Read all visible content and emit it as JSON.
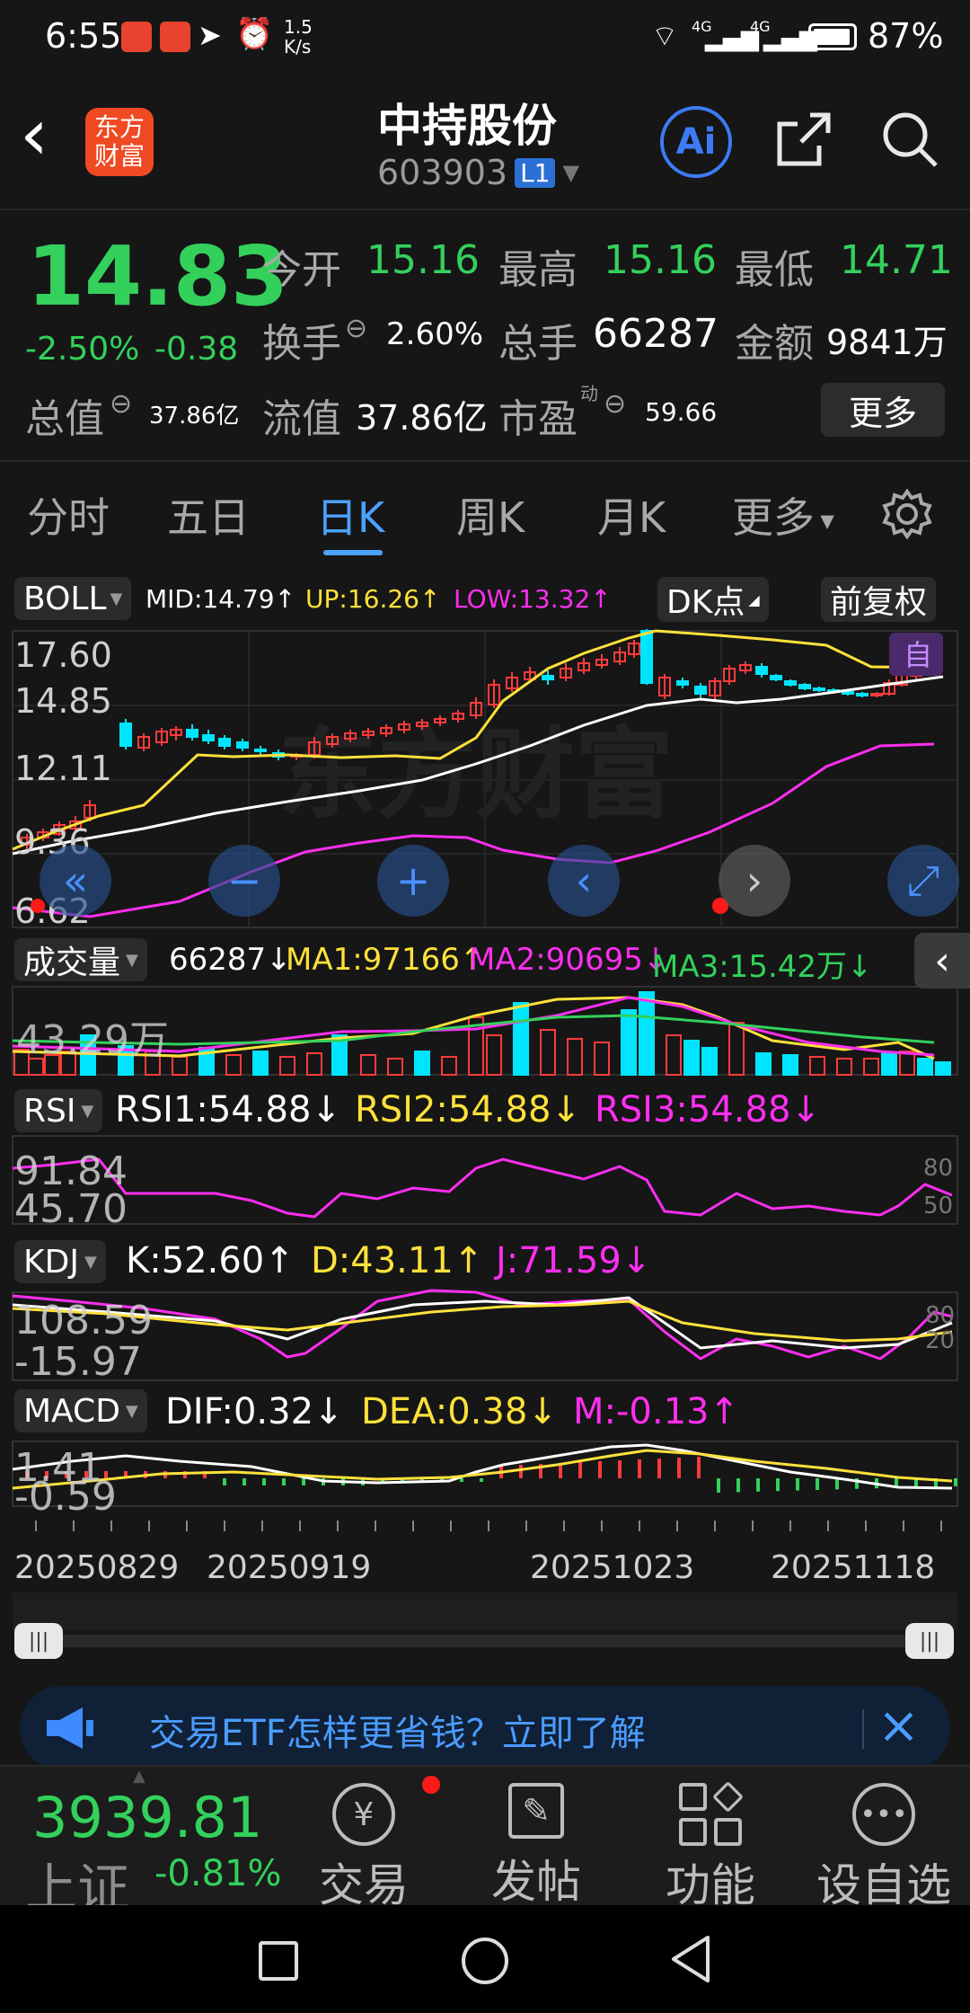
{
  "status_bar": {
    "time": "6:55",
    "speed": "1.5",
    "speed_unit": "K/s",
    "signal1": "4G",
    "signal2": "4G",
    "battery": "87%"
  },
  "header": {
    "logo": "东方\n财富",
    "name": "中持股份",
    "code": "603903",
    "level": "L1",
    "ai": "Ai"
  },
  "quote": {
    "price": "14.83",
    "change_pct": "-2.50%",
    "change": "-0.38",
    "open_label": "今开",
    "open": "15.16",
    "high_label": "最高",
    "high": "15.16",
    "low_label": "最低",
    "low": "14.71",
    "turnover_label": "换手",
    "turnover": "2.60%",
    "volume_label": "总手",
    "volume": "66287",
    "amount_label": "金额",
    "amount": "9841万",
    "mktcap_label": "总值",
    "mktcap": "37.86亿",
    "float_label": "流值",
    "float": "37.86亿",
    "pe_label": "市盈",
    "pe_sup": "动",
    "pe": "59.66",
    "more": "更多"
  },
  "tabs": [
    "分时",
    "五日",
    "日K",
    "周K",
    "月K",
    "更多"
  ],
  "active_tab": "日K",
  "boll": {
    "name": "BOLL",
    "mid": "MID:14.79↑",
    "up": "UP:16.26↑",
    "low": "LOW:13.32↑",
    "dk": "DK点",
    "adjust": "前复权",
    "self": "自",
    "y_ticks": [
      "17.60",
      "14.85",
      "12.11",
      "9.36",
      "6.62"
    ]
  },
  "volume": {
    "name": "成交量",
    "val": "66287↓",
    "ma1": "MA1:97166↑",
    "ma2": "MA2:90695↓",
    "ma3": "MA3:15.42万↓",
    "axis": "43.29万"
  },
  "rsi": {
    "name": "RSI",
    "rsi1": "RSI1:54.88↓",
    "rsi2": "RSI2:54.88↓",
    "rsi3": "RSI3:54.88↓",
    "y_max": "91.84",
    "y_min": "45.70",
    "r80": "80",
    "r50": "50"
  },
  "kdj": {
    "name": "KDJ",
    "k": "K:52.60↑",
    "d": "D:43.11↑",
    "j": "J:71.59↓",
    "y_max": "108.59",
    "y_min": "-15.97",
    "r80": "80",
    "r20": "20"
  },
  "macd": {
    "name": "MACD",
    "dif": "DIF:0.32↓",
    "dea": "DEA:0.38↓",
    "m": "M:-0.13↑",
    "y_max": "1.41",
    "y_min": "-0.59"
  },
  "dates": [
    "20250829",
    "20250919",
    "20251023",
    "20251118"
  ],
  "banner": {
    "text": "交易ETF怎样更省钱？立即了解"
  },
  "bottom": {
    "index_value": "3939.81",
    "index_name": "上证",
    "index_change": "-0.81%",
    "nav": [
      "交易",
      "发帖",
      "功能",
      "设自选"
    ]
  },
  "colors": {
    "up": "#ff3b3b",
    "down": "#00e5ff",
    "green": "#33d15c",
    "accent": "#4aa3ff",
    "yellow": "#ffe13a",
    "magenta": "#ff2ef0"
  }
}
